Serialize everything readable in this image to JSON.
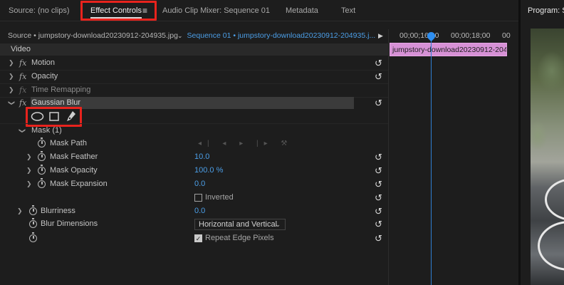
{
  "tabs": [
    {
      "label": "Source: (no clips)"
    },
    {
      "label": "Effect Controls",
      "active": true
    },
    {
      "label": "Audio Clip Mixer: Sequence 01"
    },
    {
      "label": "Metadata"
    },
    {
      "label": "Text"
    }
  ],
  "program": {
    "title": "Program: Seq"
  },
  "header": {
    "source_label": "Source • jumpstory-download20230912-204935.jpg",
    "sequence_label": "Sequence 01 • jumpstory-download20230912-204935.j..."
  },
  "timeline": {
    "ticks": [
      "00;00;16;00",
      "00;00;18;00",
      "00"
    ],
    "clip_label": "jumpstory-download20230912-2049"
  },
  "section": {
    "video": "Video"
  },
  "effects": {
    "motion": "Motion",
    "opacity": "Opacity",
    "time_remapping": "Time Remapping",
    "gaussian_blur": "Gaussian Blur"
  },
  "mask": {
    "title": "Mask (1)",
    "path": "Mask Path",
    "feather_label": "Mask Feather",
    "feather_value": "10.0",
    "opacity_label": "Mask Opacity",
    "opacity_value": "100.0 %",
    "expansion_label": "Mask Expansion",
    "expansion_value": "0.0",
    "inverted_label": "Inverted"
  },
  "blur": {
    "blurriness_label": "Blurriness",
    "blurriness_value": "0.0",
    "dimensions_label": "Blur Dimensions",
    "dimensions_value": "Horizontal and Vertical",
    "repeat_edge_label": "Repeat Edge Pixels"
  },
  "colors": {
    "accent": "#4c9fe8",
    "clip": "#d791d6",
    "highlight": "#e8231d"
  }
}
